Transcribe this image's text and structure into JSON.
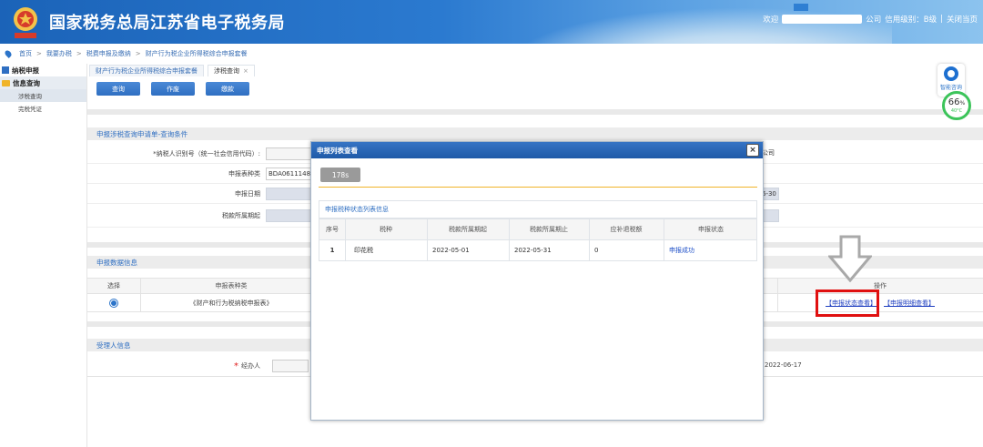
{
  "header": {
    "title": "国家税务总局江苏省电子税务局",
    "welcome": "欢迎",
    "company_suffix": "公司",
    "credit_level": "信用级别：B级",
    "divider": "|",
    "close_page": "关闭当页",
    "colors": {
      "header_start": "#1b63b8",
      "header_end": "#8cc3ee"
    }
  },
  "breadcrumb": [
    "首页",
    "我要办税",
    "税费申报及缴纳",
    "财产行为税企业所得税综合申报套餐"
  ],
  "breadcrumb_sep": ">",
  "sidebar": {
    "items": [
      {
        "label": "纳税申报",
        "icon": "grid-icon"
      },
      {
        "label": "信息查询",
        "icon": "folder-icon"
      }
    ],
    "subitems": [
      "涉税查询",
      "完税凭证"
    ]
  },
  "tabs": [
    {
      "label": "财产行为税企业所得税综合申报套餐"
    },
    {
      "label": "涉税查询",
      "close": "×"
    }
  ],
  "toolbar": {
    "query": "查询",
    "void": "作废",
    "pay": "缴款"
  },
  "query_section": {
    "title": "申报涉税查询申请单-查询条件",
    "taxpayer_label": "*纳税人识别号（统一社会信用代码）:",
    "form_type_label": "申报表种类",
    "form_type_value": "BDA0611148",
    "declare_date_label": "申报日期",
    "tax_period_label": "税款所属期起",
    "right_company": "公司",
    "right_date": "6-30"
  },
  "data_section": {
    "title": "申报数据信息",
    "headers": {
      "select": "选择",
      "form_type": "申报表种类",
      "action": "操作"
    },
    "row": {
      "form_name": "《财产和行为税纳税申报表》",
      "status_link": "【申报状态查看】",
      "detail_link": "【申报明细查看】"
    }
  },
  "handler_section": {
    "title": "受理人信息",
    "handler_label": "经办人",
    "handler_date": "2022-06-17"
  },
  "widgets": {
    "service_label": "智能咨询",
    "gauge_percent": "66",
    "gauge_unit": "%",
    "gauge_temp": "40°C"
  },
  "modal": {
    "title": "申报列表查看",
    "close": "×",
    "timer": "178s",
    "table_title": "申报税种状态列表信息",
    "headers": [
      "序号",
      "税种",
      "税款所属期起",
      "税款所属期止",
      "应补退税额",
      "申报状态"
    ],
    "rows": [
      {
        "no": "1",
        "tax": "印花税",
        "start": "2022-05-01",
        "end": "2022-05-31",
        "amount": "0",
        "status": "申报成功"
      }
    ]
  }
}
